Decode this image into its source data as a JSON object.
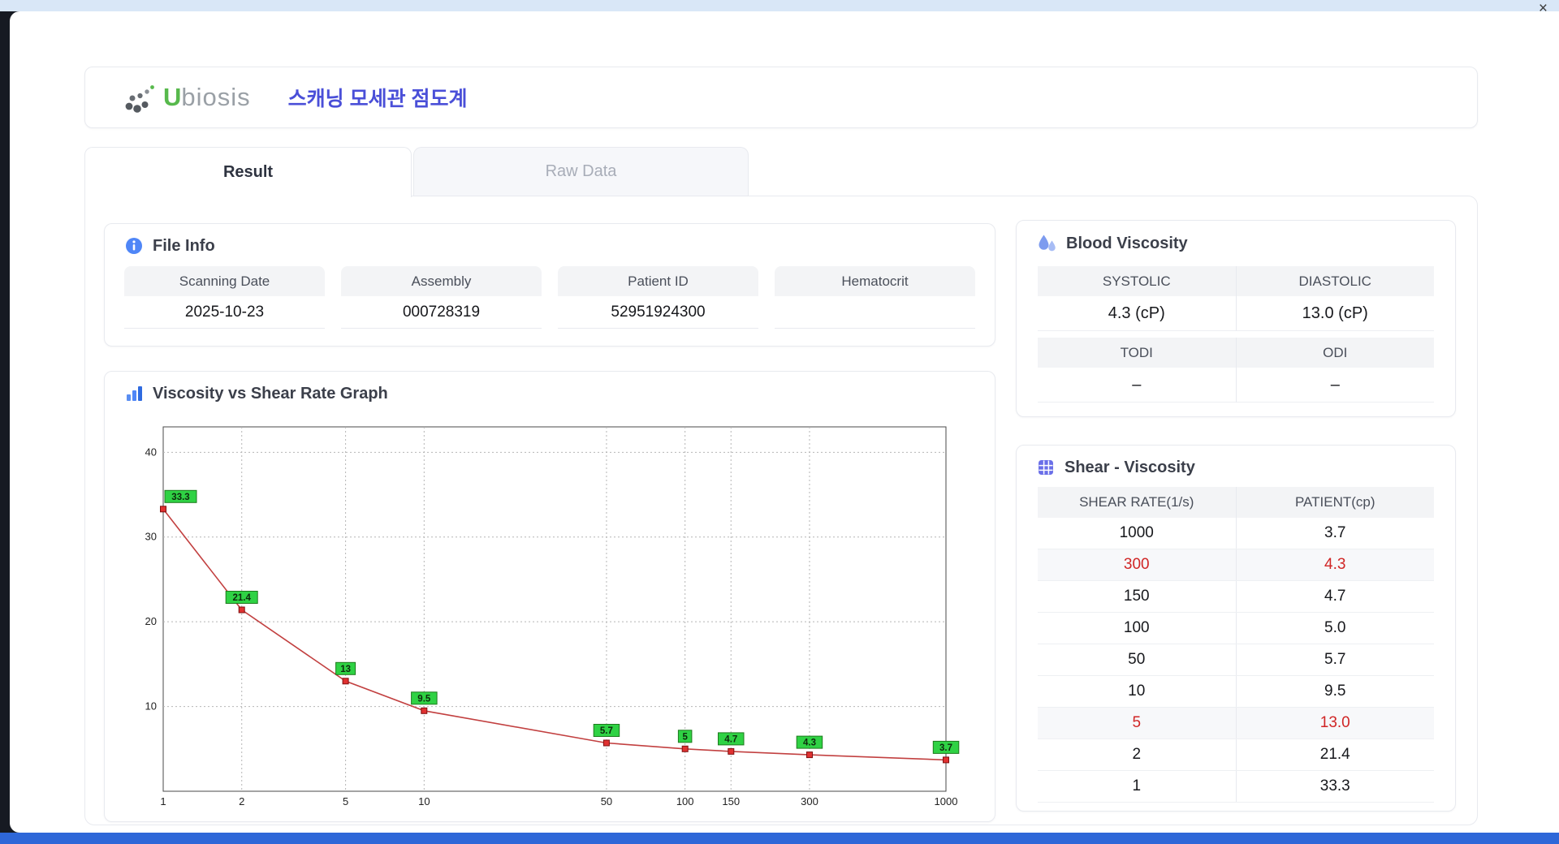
{
  "window": {
    "close": "×"
  },
  "header": {
    "brand_u": "U",
    "brand_rest": "biosis",
    "title": "스캐닝 모세관 점도계"
  },
  "tabs": {
    "result": "Result",
    "raw": "Raw Data"
  },
  "file_info": {
    "title": "File Info",
    "fields": [
      {
        "label": "Scanning Date",
        "value": "2025-10-23"
      },
      {
        "label": "Assembly",
        "value": "000728319"
      },
      {
        "label": "Patient ID",
        "value": "52951924300"
      },
      {
        "label": "Hematocrit",
        "value": ""
      }
    ]
  },
  "blood_viscosity": {
    "title": "Blood Viscosity",
    "cells": [
      {
        "label": "SYSTOLIC",
        "value": "4.3 (cP)"
      },
      {
        "label": "DIASTOLIC",
        "value": "13.0 (cP)"
      },
      {
        "label": "TODI",
        "value": "–"
      },
      {
        "label": "ODI",
        "value": "–"
      }
    ]
  },
  "graph": {
    "title": "Viscosity vs Shear Rate Graph"
  },
  "chart_data": {
    "type": "line",
    "title": "Viscosity vs Shear Rate Graph",
    "xlabel": "",
    "ylabel": "",
    "x_scale": "log",
    "grid": true,
    "x": [
      1,
      2,
      5,
      10,
      50,
      100,
      150,
      300,
      1000
    ],
    "values": [
      33.3,
      21.4,
      13,
      9.5,
      5.7,
      5,
      4.7,
      4.3,
      3.7
    ],
    "point_labels": [
      "33.3",
      "21.4",
      "13",
      "9.5",
      "5.7",
      "5",
      "4.7",
      "4.3",
      "3.7"
    ],
    "x_ticks": [
      "1",
      "2",
      "5",
      "10",
      "50",
      "100",
      "150",
      "300",
      "1000"
    ],
    "y_ticks": [
      10,
      20,
      30,
      40
    ],
    "xlim": [
      1,
      1000
    ],
    "ylim": [
      0,
      43
    ],
    "line_color": "#c24040",
    "marker_color": "#e03131",
    "label_bg": "#2fd244",
    "label_border": "#1d7a1d"
  },
  "shear_table": {
    "title": "Shear - Viscosity",
    "columns": [
      "SHEAR RATE(1/s)",
      "PATIENT(cp)"
    ],
    "rows": [
      {
        "shear": "1000",
        "patient": "3.7",
        "highlight": false
      },
      {
        "shear": "300",
        "patient": "4.3",
        "highlight": true
      },
      {
        "shear": "150",
        "patient": "4.7",
        "highlight": false
      },
      {
        "shear": "100",
        "patient": "5.0",
        "highlight": false
      },
      {
        "shear": "50",
        "patient": "5.7",
        "highlight": false
      },
      {
        "shear": "10",
        "patient": "9.5",
        "highlight": false
      },
      {
        "shear": "5",
        "patient": "13.0",
        "highlight": true
      },
      {
        "shear": "2",
        "patient": "21.4",
        "highlight": false
      },
      {
        "shear": "1",
        "patient": "33.3",
        "highlight": false
      }
    ]
  }
}
